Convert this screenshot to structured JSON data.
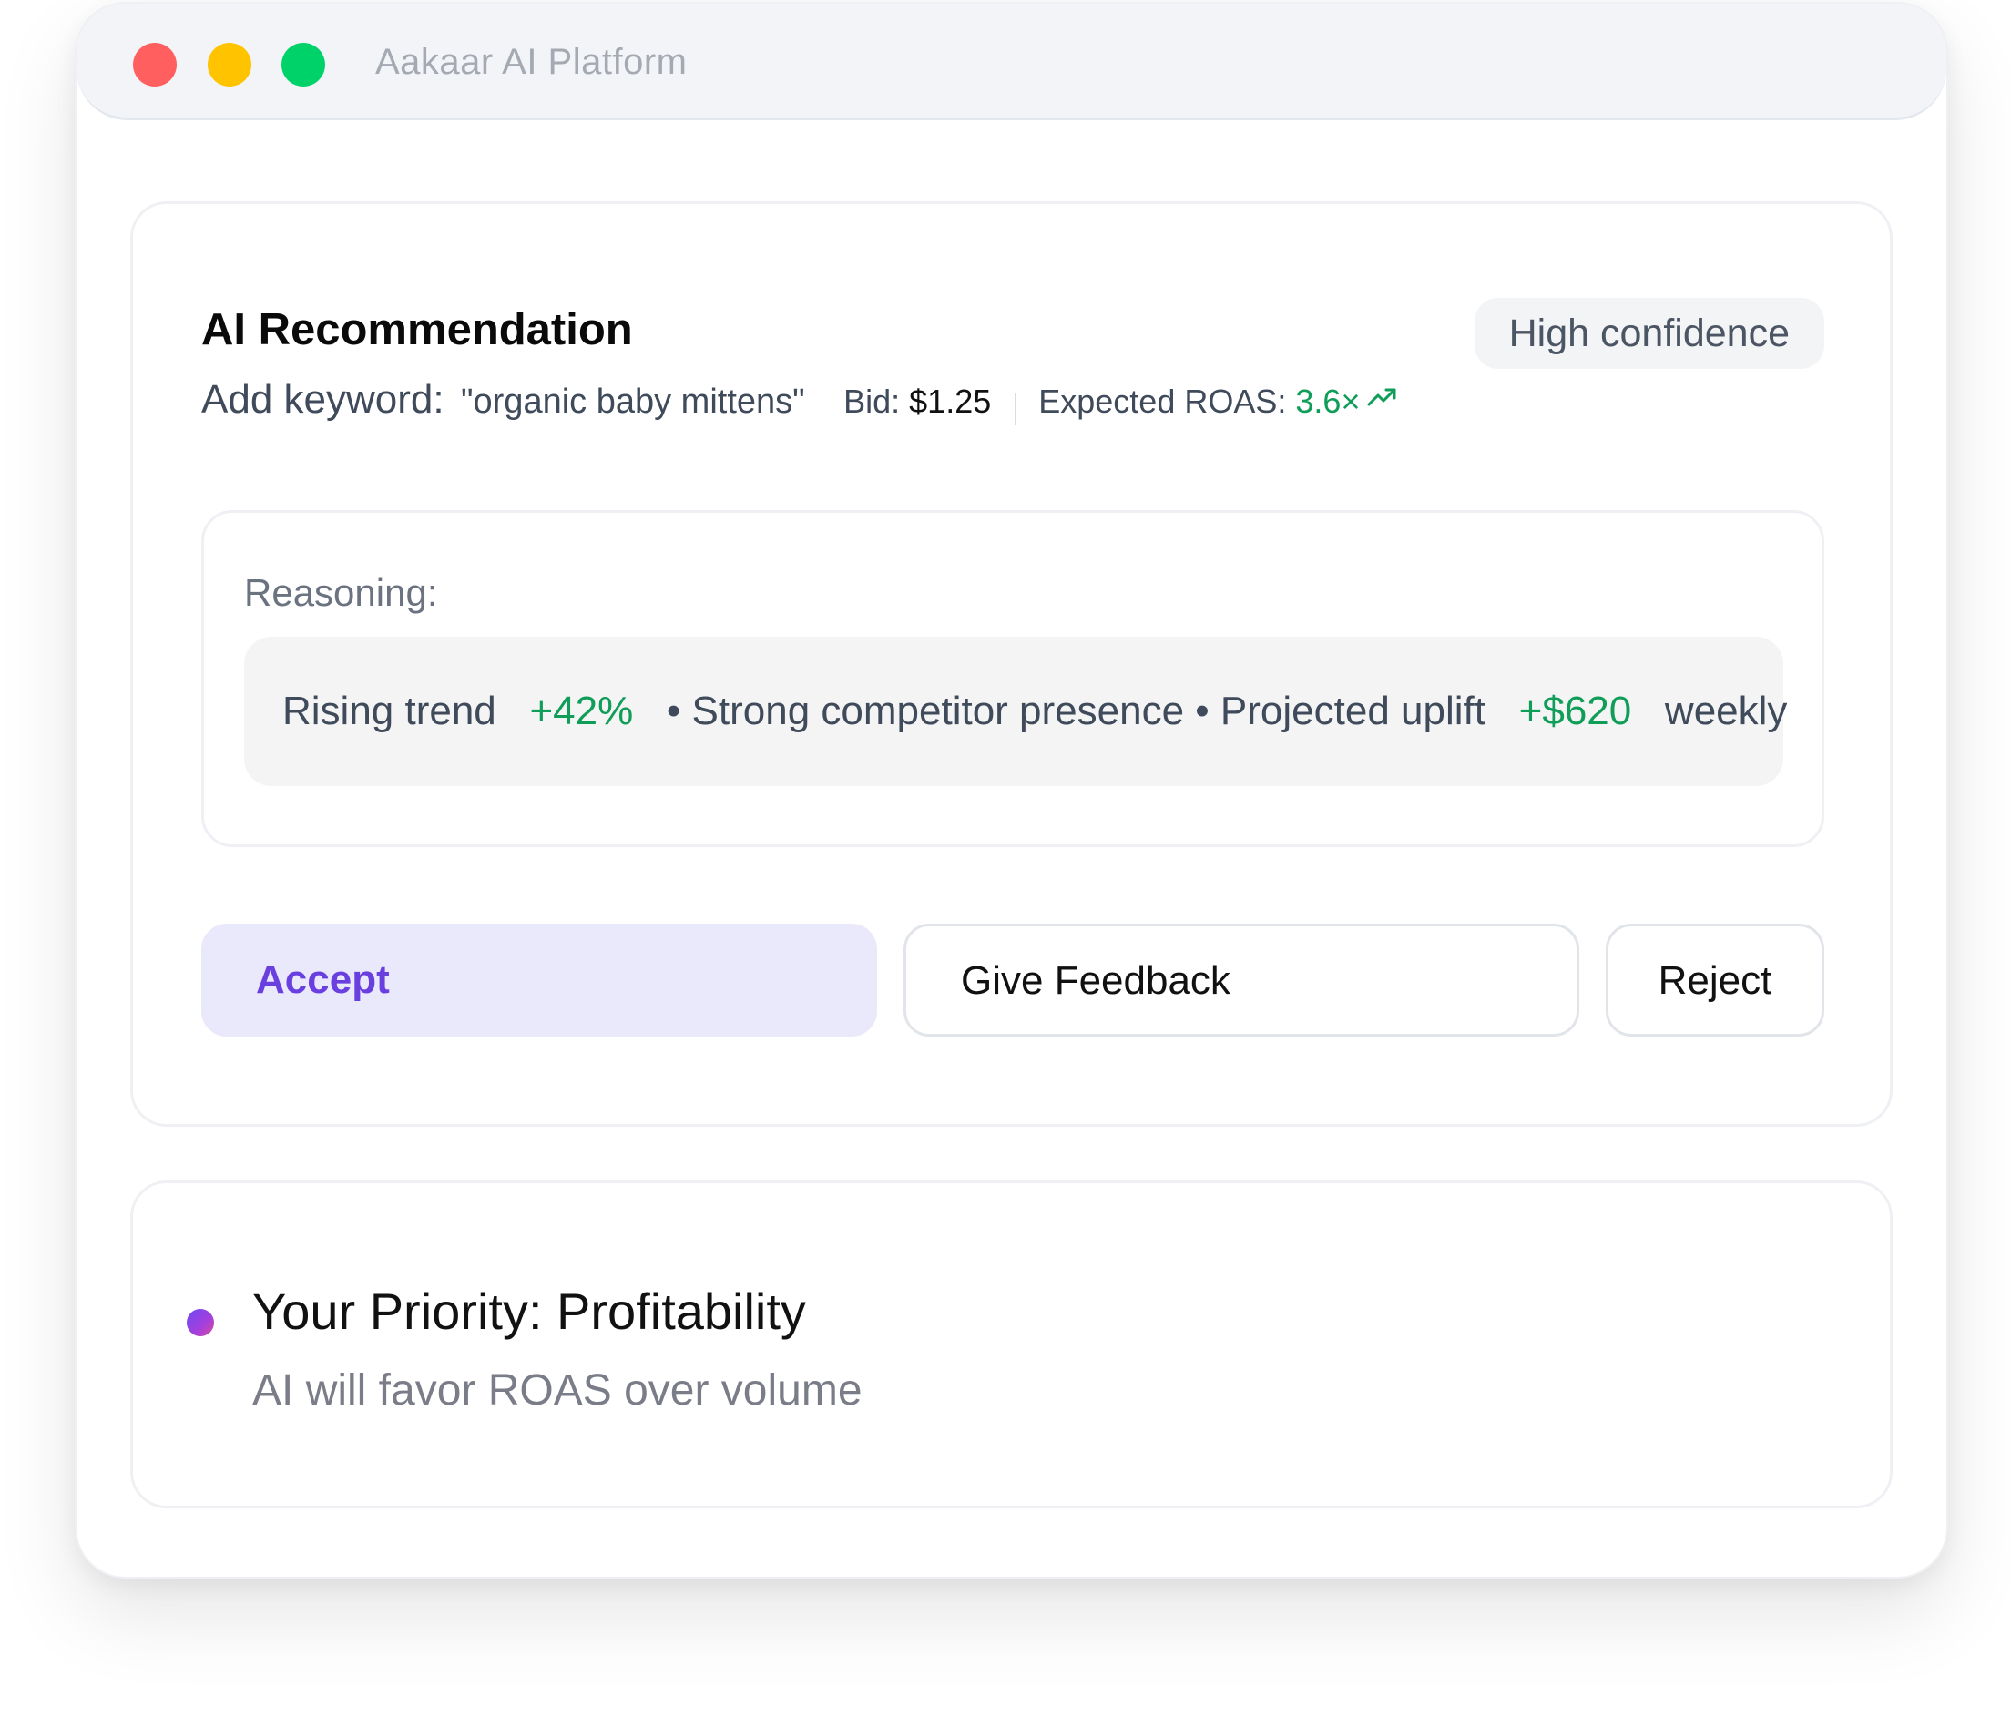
{
  "window": {
    "title": "Aakaar AI Platform",
    "controls": [
      "close",
      "minimize",
      "maximize"
    ]
  },
  "recommendation": {
    "title": "AI Recommendation",
    "confidence_badge": "High confidence",
    "keyword_label": "Add keyword:",
    "keyword_value": "\"organic baby mittens\"",
    "bid_label": "Bid:",
    "bid_value": "$1.25",
    "roas_label": "Expected ROAS:",
    "roas_value": "3.6×",
    "roas_icon": "trending-up-icon",
    "reasoning": {
      "label": "Reasoning:",
      "part1": "Rising trend",
      "trend_value": "+42%",
      "part2": "• Strong competitor presence • Projected uplift",
      "uplift_value": "+$620",
      "part3": "weekly"
    },
    "actions": {
      "accept": "Accept",
      "feedback": "Give Feedback",
      "reject": "Reject"
    }
  },
  "priority": {
    "title": "Your Priority: Profitability",
    "subtitle": "AI will favor ROAS over volume"
  },
  "colors": {
    "positive": "#0f9d58",
    "accent": "#6a3fe0",
    "accent_bg": "#eae8fb",
    "close": "#ff5f5f",
    "minimize": "#ffc300",
    "maximize": "#00d26a"
  }
}
